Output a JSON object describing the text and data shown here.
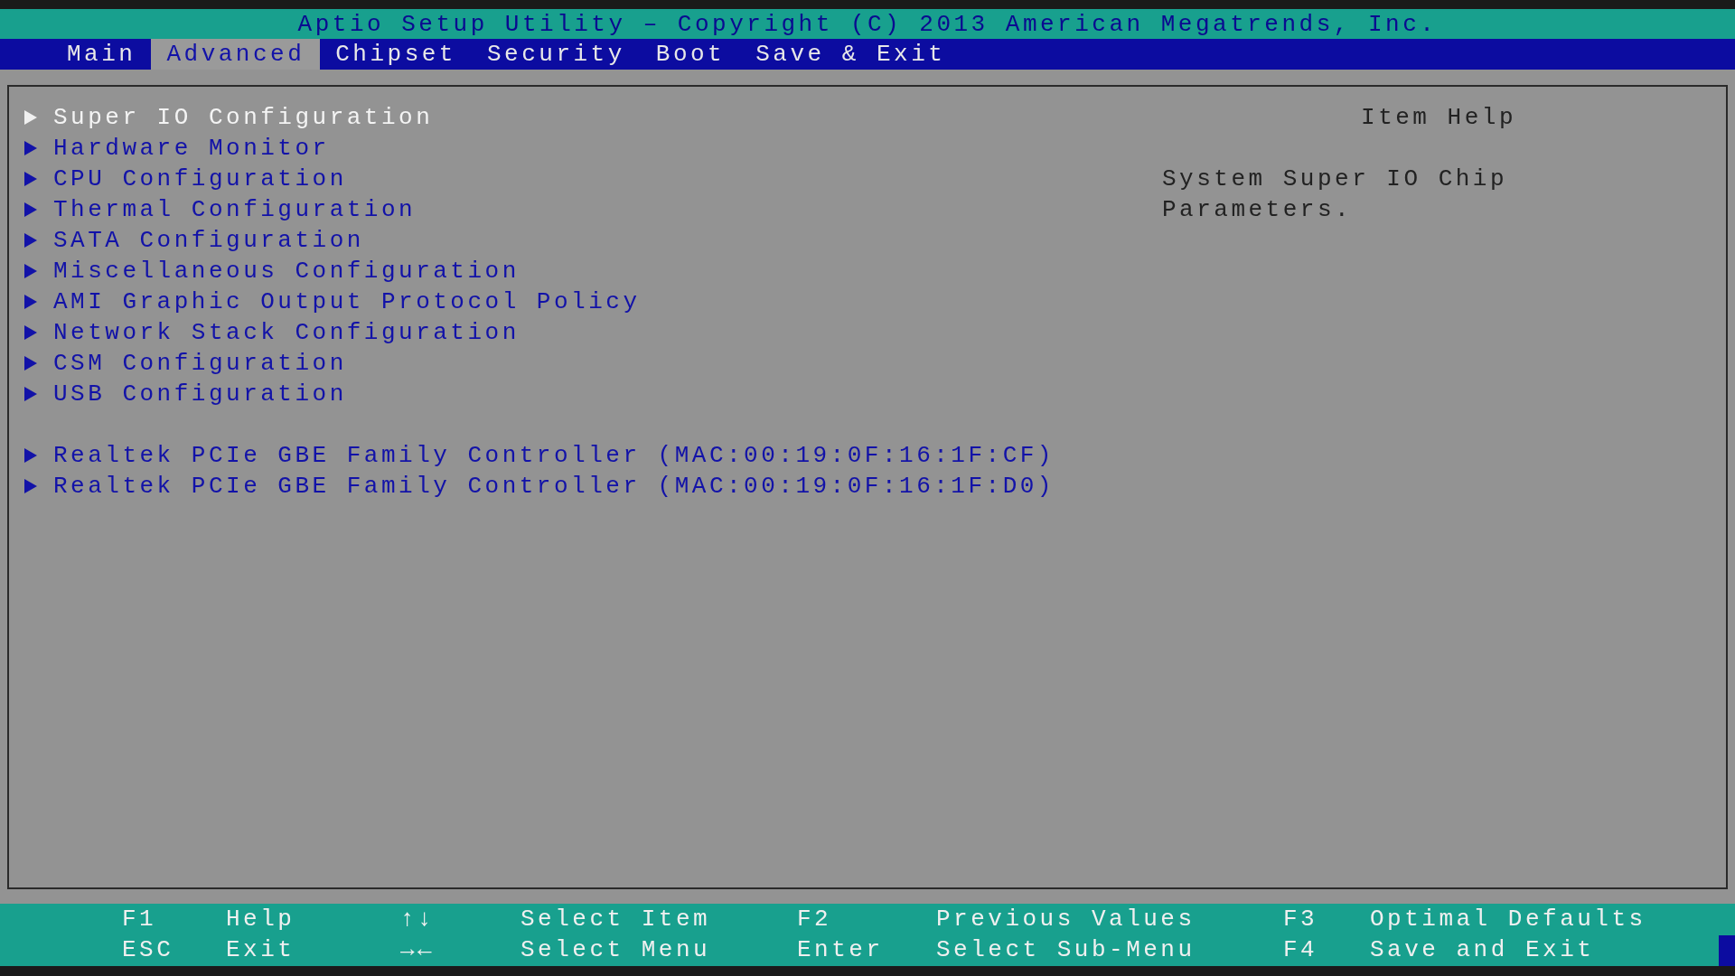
{
  "title": "Aptio Setup Utility – Copyright (C) 2013 American Megatrends, Inc.",
  "tabs": [
    {
      "label": "Main",
      "selected": false
    },
    {
      "label": "Advanced",
      "selected": true
    },
    {
      "label": "Chipset",
      "selected": false
    },
    {
      "label": "Security",
      "selected": false
    },
    {
      "label": "Boot",
      "selected": false
    },
    {
      "label": "Save & Exit",
      "selected": false
    }
  ],
  "menu_groups": [
    {
      "items": [
        {
          "label": "Super IO Configuration",
          "selected": true
        },
        {
          "label": "Hardware Monitor",
          "selected": false
        },
        {
          "label": "CPU Configuration",
          "selected": false
        },
        {
          "label": "Thermal Configuration",
          "selected": false
        },
        {
          "label": "SATA Configuration",
          "selected": false
        },
        {
          "label": "Miscellaneous Configuration",
          "selected": false
        },
        {
          "label": "AMI Graphic Output Protocol Policy",
          "selected": false
        },
        {
          "label": "Network Stack Configuration",
          "selected": false
        },
        {
          "label": "CSM Configuration",
          "selected": false
        },
        {
          "label": "USB Configuration",
          "selected": false
        }
      ]
    },
    {
      "items": [
        {
          "label": "Realtek PCIe GBE Family Controller (MAC:00:19:0F:16:1F:CF)",
          "selected": false
        },
        {
          "label": "Realtek PCIe GBE Family Controller (MAC:00:19:0F:16:1F:D0)",
          "selected": false
        }
      ]
    }
  ],
  "help": {
    "title": "Item Help",
    "text": "System Super IO Chip Parameters."
  },
  "key_legend": [
    [
      {
        "key": "F1",
        "action": "Help"
      },
      {
        "key": "↑↓",
        "action": "Select Item"
      },
      {
        "key": "F2",
        "action": "Previous Values"
      },
      {
        "key": "F3",
        "action": "Optimal Defaults"
      }
    ],
    [
      {
        "key": "ESC",
        "action": "Exit"
      },
      {
        "key": "→←",
        "action": "Select Menu"
      },
      {
        "key": "Enter",
        "action": "Select Sub-Menu"
      },
      {
        "key": "F4",
        "action": "Save and Exit"
      }
    ]
  ]
}
